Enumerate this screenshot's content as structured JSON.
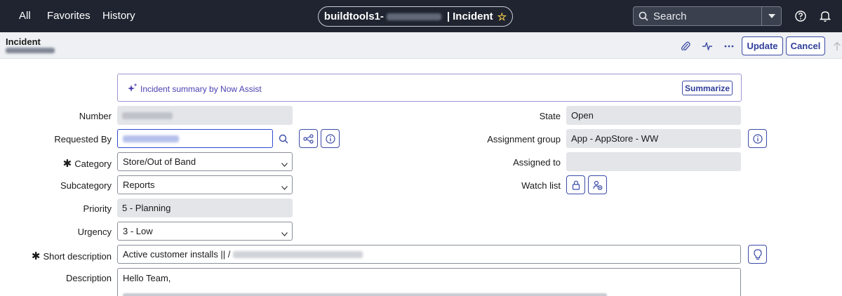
{
  "topnav": {
    "all": "All",
    "favorites": "Favorites",
    "history": "History",
    "title_prefix": "buildtools1-",
    "title_sep": "|",
    "title_suffix": "Incident",
    "search_placeholder": "Search"
  },
  "header": {
    "record_type": "Incident",
    "update_label": "Update",
    "cancel_label": "Cancel"
  },
  "banner": {
    "text": "Incident summary by Now Assist",
    "summarize_label": "Summarize"
  },
  "form": {
    "number_label": "Number",
    "requested_by_label": "Requested By",
    "category_label": "Category",
    "category_value": "Store/Out of Band",
    "subcategory_label": "Subcategory",
    "subcategory_value": "Reports",
    "priority_label": "Priority",
    "priority_value": "5 - Planning",
    "urgency_label": "Urgency",
    "urgency_value": "3 - Low",
    "short_description_label": "Short description",
    "short_description_value": "Active customer installs || /",
    "description_label": "Description",
    "description_value": "Hello Team,",
    "state_label": "State",
    "state_value": "Open",
    "assignment_group_label": "Assignment group",
    "assignment_group_value": "App - AppStore - WW",
    "assigned_to_label": "Assigned to",
    "assigned_to_value": "",
    "watch_list_label": "Watch list",
    "required_mark": "✱"
  }
}
